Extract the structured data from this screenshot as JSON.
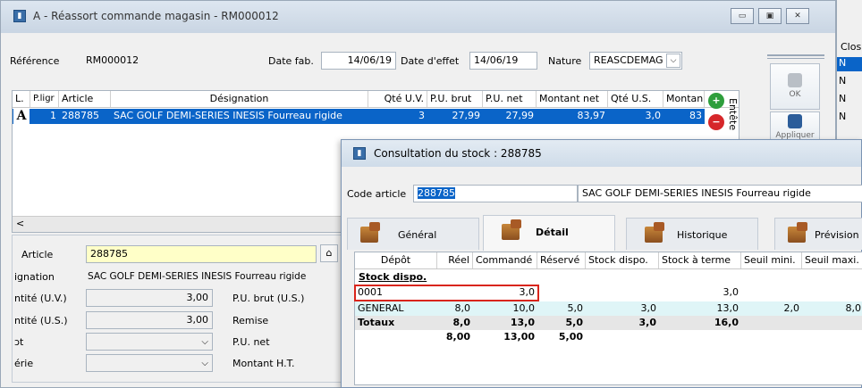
{
  "main": {
    "title": "A - Réassort commande magasin - RM000012",
    "reference_label": "Référence",
    "reference_value": "RM000012",
    "datefab_label": "Date fab.",
    "datefab_value": "14/06/19",
    "dateeffet_label": "Date d'effet",
    "dateeffet_value": "14/06/19",
    "nature_label": "Nature",
    "nature_value": "REASCDEMAG",
    "grid_headers": [
      "L.",
      "P.ligr",
      "Article",
      "Désignation",
      "Qté U.V.",
      "P.U. brut",
      "P.U. net",
      "Montant net",
      "Qté U.S.",
      "Montan"
    ],
    "grid_row": {
      "l": "A",
      "ligne": "1",
      "article": "288785",
      "designation": "SAC GOLF DEMI-SERIES INESIS Fourreau rigide",
      "qte_uv": "3",
      "pu_brut": "27,99",
      "pu_net": "27,99",
      "montant_net": "83,97",
      "qte_us": "3,0",
      "montan": "83"
    },
    "entete_label": "Entête",
    "ok_label": "OK",
    "appliquer_label": "Appliquer",
    "scroll_left": "<",
    "clos_header": "Clos",
    "clos_values": [
      "N",
      "N",
      "N",
      "N"
    ]
  },
  "form": {
    "article_label": "Article",
    "article_value": "288785",
    "designation_label": "ignation",
    "designation_value": "SAC GOLF DEMI-SERIES INESIS Fourreau rigide",
    "qte_uv_label": "ntité (U.V.)",
    "qte_uv_value": "3,00",
    "pu_brut_label": "P.U. brut (U.S.)",
    "qte_us_label": "ntité (U.S.)",
    "qte_us_value": "3,00",
    "remise_label": "Remise",
    "dot_label": "ɔt",
    "pu_net_label": "P.U. net",
    "serie_label": "érie",
    "montant_ht_label": "Montant H.T."
  },
  "popup": {
    "title": "Consultation du stock : 288785",
    "code_label": "Code article",
    "code_value": "288785",
    "designation_value": "SAC GOLF DEMI-SERIES INESIS Fourreau rigide",
    "tabs": [
      "Général",
      "Détail",
      "Historique",
      "Prévision"
    ],
    "headers": [
      "Dépôt",
      "Réel",
      "Commandé",
      "Réservé",
      "Stock dispo.",
      "Stock à terme",
      "Seuil mini.",
      "Seuil maxi."
    ],
    "section_label": "Stock dispo.",
    "rows": [
      {
        "depot": "0001",
        "reel": "",
        "commande": "3,0",
        "reserve": "",
        "dispo": "",
        "terme": "3,0",
        "mini": "",
        "maxi": ""
      },
      {
        "depot": "GENERAL",
        "reel": "8,0",
        "commande": "10,0",
        "reserve": "5,0",
        "dispo": "3,0",
        "terme": "13,0",
        "mini": "2,0",
        "maxi": "8,0"
      }
    ],
    "totals": {
      "depot": "Totaux",
      "reel": "8,0",
      "commande": "13,0",
      "reserve": "5,0",
      "dispo": "3,0",
      "terme": "16,0"
    },
    "totals2": {
      "reel": "8,00",
      "commande": "13,00",
      "reserve": "5,00"
    }
  },
  "colors": {
    "selected_row": "#0a64c8",
    "highlight_box": "#d9251c",
    "general_row": "#dff5f7",
    "article_field": "#ffffc8"
  }
}
